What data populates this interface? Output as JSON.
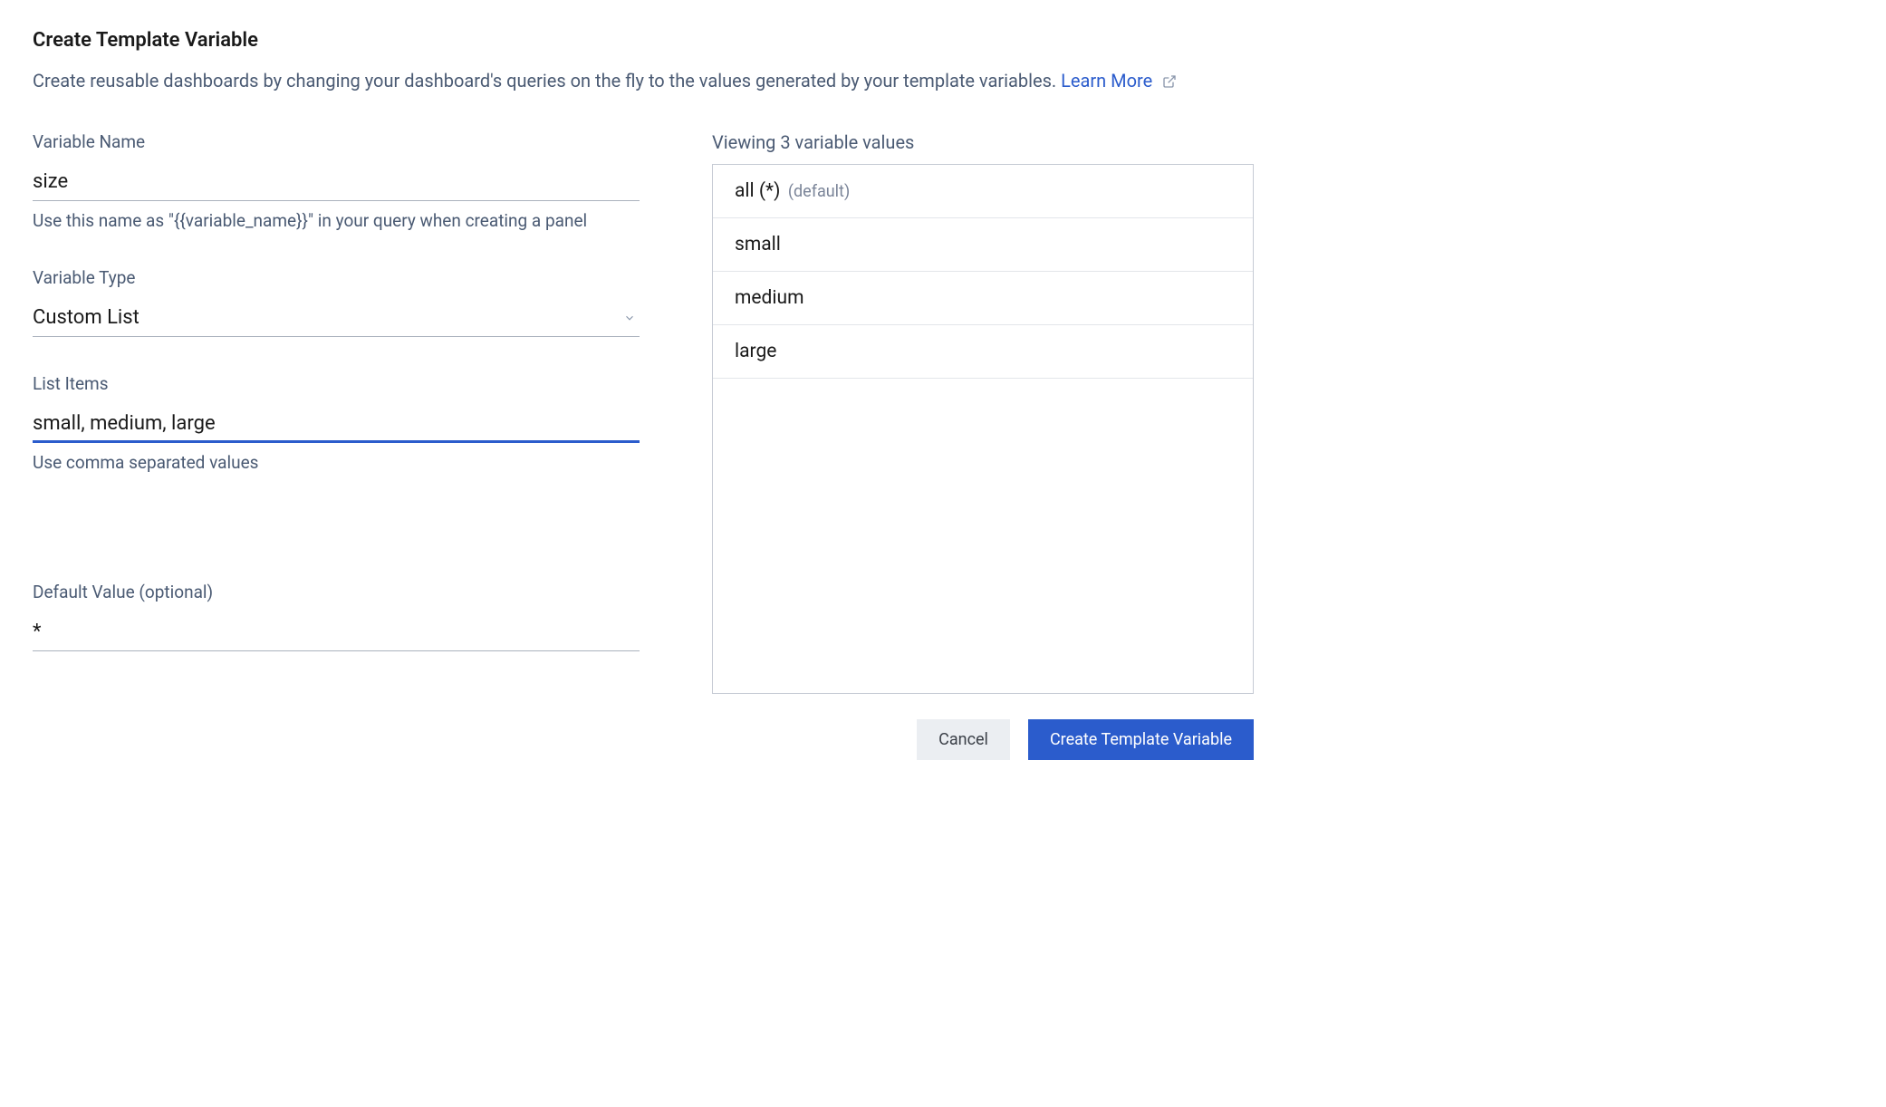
{
  "header": {
    "title": "Create Template Variable",
    "description": "Create reusable dashboards by changing your dashboard's queries on the fly to the values generated by your template variables. ",
    "learn_more": "Learn More"
  },
  "form": {
    "variable_name": {
      "label": "Variable Name",
      "value": "size",
      "hint": "Use this name as \"{{variable_name}}\" in your query when creating a panel"
    },
    "variable_type": {
      "label": "Variable Type",
      "value": "Custom List"
    },
    "list_items": {
      "label": "List Items",
      "value": "small, medium, large",
      "hint": "Use comma separated values"
    },
    "default_value": {
      "label": "Default Value (optional)",
      "value": "*"
    }
  },
  "preview": {
    "heading": "Viewing 3 variable values",
    "default_tag": "(default)",
    "items": [
      {
        "label": "all (*)",
        "is_default": true
      },
      {
        "label": "small",
        "is_default": false
      },
      {
        "label": "medium",
        "is_default": false
      },
      {
        "label": "large",
        "is_default": false
      }
    ]
  },
  "buttons": {
    "cancel": "Cancel",
    "create": "Create Template Variable"
  }
}
